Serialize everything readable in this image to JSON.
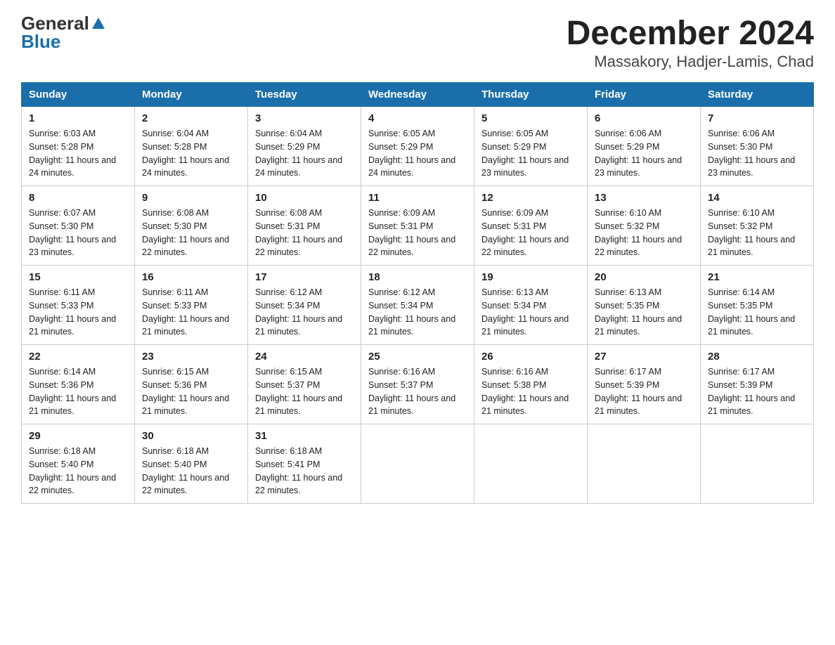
{
  "header": {
    "title": "December 2024",
    "subtitle": "Massakory, Hadjer-Lamis, Chad"
  },
  "logo": {
    "general": "General",
    "blue": "Blue"
  },
  "weekdays": [
    "Sunday",
    "Monday",
    "Tuesday",
    "Wednesday",
    "Thursday",
    "Friday",
    "Saturday"
  ],
  "weeks": [
    [
      {
        "day": "1",
        "sunrise": "6:03 AM",
        "sunset": "5:28 PM",
        "daylight": "11 hours and 24 minutes."
      },
      {
        "day": "2",
        "sunrise": "6:04 AM",
        "sunset": "5:28 PM",
        "daylight": "11 hours and 24 minutes."
      },
      {
        "day": "3",
        "sunrise": "6:04 AM",
        "sunset": "5:29 PM",
        "daylight": "11 hours and 24 minutes."
      },
      {
        "day": "4",
        "sunrise": "6:05 AM",
        "sunset": "5:29 PM",
        "daylight": "11 hours and 24 minutes."
      },
      {
        "day": "5",
        "sunrise": "6:05 AM",
        "sunset": "5:29 PM",
        "daylight": "11 hours and 23 minutes."
      },
      {
        "day": "6",
        "sunrise": "6:06 AM",
        "sunset": "5:29 PM",
        "daylight": "11 hours and 23 minutes."
      },
      {
        "day": "7",
        "sunrise": "6:06 AM",
        "sunset": "5:30 PM",
        "daylight": "11 hours and 23 minutes."
      }
    ],
    [
      {
        "day": "8",
        "sunrise": "6:07 AM",
        "sunset": "5:30 PM",
        "daylight": "11 hours and 23 minutes."
      },
      {
        "day": "9",
        "sunrise": "6:08 AM",
        "sunset": "5:30 PM",
        "daylight": "11 hours and 22 minutes."
      },
      {
        "day": "10",
        "sunrise": "6:08 AM",
        "sunset": "5:31 PM",
        "daylight": "11 hours and 22 minutes."
      },
      {
        "day": "11",
        "sunrise": "6:09 AM",
        "sunset": "5:31 PM",
        "daylight": "11 hours and 22 minutes."
      },
      {
        "day": "12",
        "sunrise": "6:09 AM",
        "sunset": "5:31 PM",
        "daylight": "11 hours and 22 minutes."
      },
      {
        "day": "13",
        "sunrise": "6:10 AM",
        "sunset": "5:32 PM",
        "daylight": "11 hours and 22 minutes."
      },
      {
        "day": "14",
        "sunrise": "6:10 AM",
        "sunset": "5:32 PM",
        "daylight": "11 hours and 21 minutes."
      }
    ],
    [
      {
        "day": "15",
        "sunrise": "6:11 AM",
        "sunset": "5:33 PM",
        "daylight": "11 hours and 21 minutes."
      },
      {
        "day": "16",
        "sunrise": "6:11 AM",
        "sunset": "5:33 PM",
        "daylight": "11 hours and 21 minutes."
      },
      {
        "day": "17",
        "sunrise": "6:12 AM",
        "sunset": "5:34 PM",
        "daylight": "11 hours and 21 minutes."
      },
      {
        "day": "18",
        "sunrise": "6:12 AM",
        "sunset": "5:34 PM",
        "daylight": "11 hours and 21 minutes."
      },
      {
        "day": "19",
        "sunrise": "6:13 AM",
        "sunset": "5:34 PM",
        "daylight": "11 hours and 21 minutes."
      },
      {
        "day": "20",
        "sunrise": "6:13 AM",
        "sunset": "5:35 PM",
        "daylight": "11 hours and 21 minutes."
      },
      {
        "day": "21",
        "sunrise": "6:14 AM",
        "sunset": "5:35 PM",
        "daylight": "11 hours and 21 minutes."
      }
    ],
    [
      {
        "day": "22",
        "sunrise": "6:14 AM",
        "sunset": "5:36 PM",
        "daylight": "11 hours and 21 minutes."
      },
      {
        "day": "23",
        "sunrise": "6:15 AM",
        "sunset": "5:36 PM",
        "daylight": "11 hours and 21 minutes."
      },
      {
        "day": "24",
        "sunrise": "6:15 AM",
        "sunset": "5:37 PM",
        "daylight": "11 hours and 21 minutes."
      },
      {
        "day": "25",
        "sunrise": "6:16 AM",
        "sunset": "5:37 PM",
        "daylight": "11 hours and 21 minutes."
      },
      {
        "day": "26",
        "sunrise": "6:16 AM",
        "sunset": "5:38 PM",
        "daylight": "11 hours and 21 minutes."
      },
      {
        "day": "27",
        "sunrise": "6:17 AM",
        "sunset": "5:39 PM",
        "daylight": "11 hours and 21 minutes."
      },
      {
        "day": "28",
        "sunrise": "6:17 AM",
        "sunset": "5:39 PM",
        "daylight": "11 hours and 21 minutes."
      }
    ],
    [
      {
        "day": "29",
        "sunrise": "6:18 AM",
        "sunset": "5:40 PM",
        "daylight": "11 hours and 22 minutes."
      },
      {
        "day": "30",
        "sunrise": "6:18 AM",
        "sunset": "5:40 PM",
        "daylight": "11 hours and 22 minutes."
      },
      {
        "day": "31",
        "sunrise": "6:18 AM",
        "sunset": "5:41 PM",
        "daylight": "11 hours and 22 minutes."
      },
      null,
      null,
      null,
      null
    ]
  ]
}
